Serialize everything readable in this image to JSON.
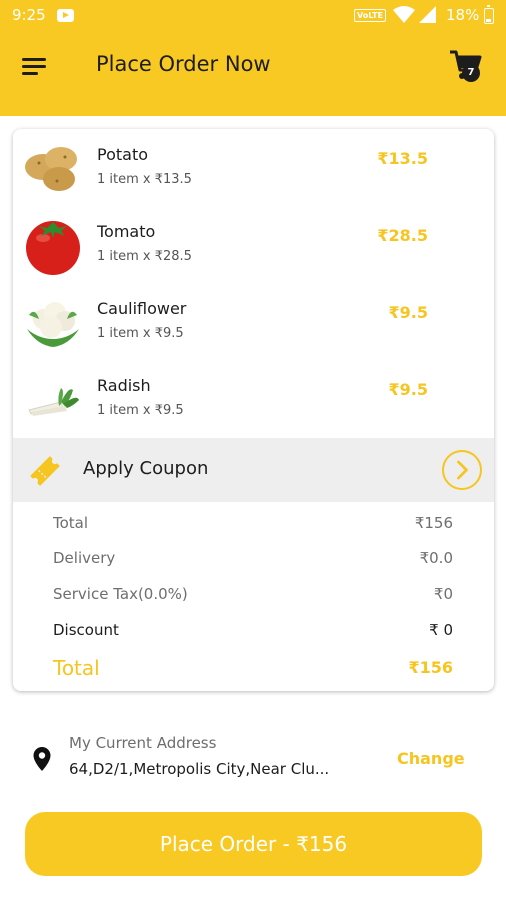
{
  "status_bar": {
    "time": "9:25",
    "volte": "VoLTE",
    "battery": "18%"
  },
  "header": {
    "title": "Place Order Now",
    "cart_count": "7"
  },
  "items": [
    {
      "name": "Potato",
      "qty": "1 item x ₹13.5",
      "price": "₹13.5",
      "icon": "potato-image"
    },
    {
      "name": "Tomato",
      "qty": "1 item x ₹28.5",
      "price": "₹28.5",
      "icon": "tomato-image"
    },
    {
      "name": "Cauliflower",
      "qty": "1 item x ₹9.5",
      "price": "₹9.5",
      "icon": "cauliflower-image"
    },
    {
      "name": "Radish",
      "qty": "1 item x ₹9.5",
      "price": "₹9.5",
      "icon": "radish-image"
    }
  ],
  "coupon": {
    "label": "Apply Coupon"
  },
  "summary": {
    "total_label": "Total",
    "total_value": "₹156",
    "delivery_label": "Delivery",
    "delivery_value": "₹0.0",
    "tax_label": "Service Tax(0.0%)",
    "tax_value": "₹0",
    "discount_label": "Discount",
    "discount_value": "₹ 0",
    "grand_total_label": "Total",
    "grand_total_value": "₹156"
  },
  "address": {
    "label": "My Current Address",
    "text": "64,D2/1,Metropolis City,Near Clu...",
    "change_label": "Change"
  },
  "place_order": {
    "label": "Place Order - ₹156"
  },
  "colors": {
    "accent": "#f9c923",
    "price": "#f6c51f"
  }
}
